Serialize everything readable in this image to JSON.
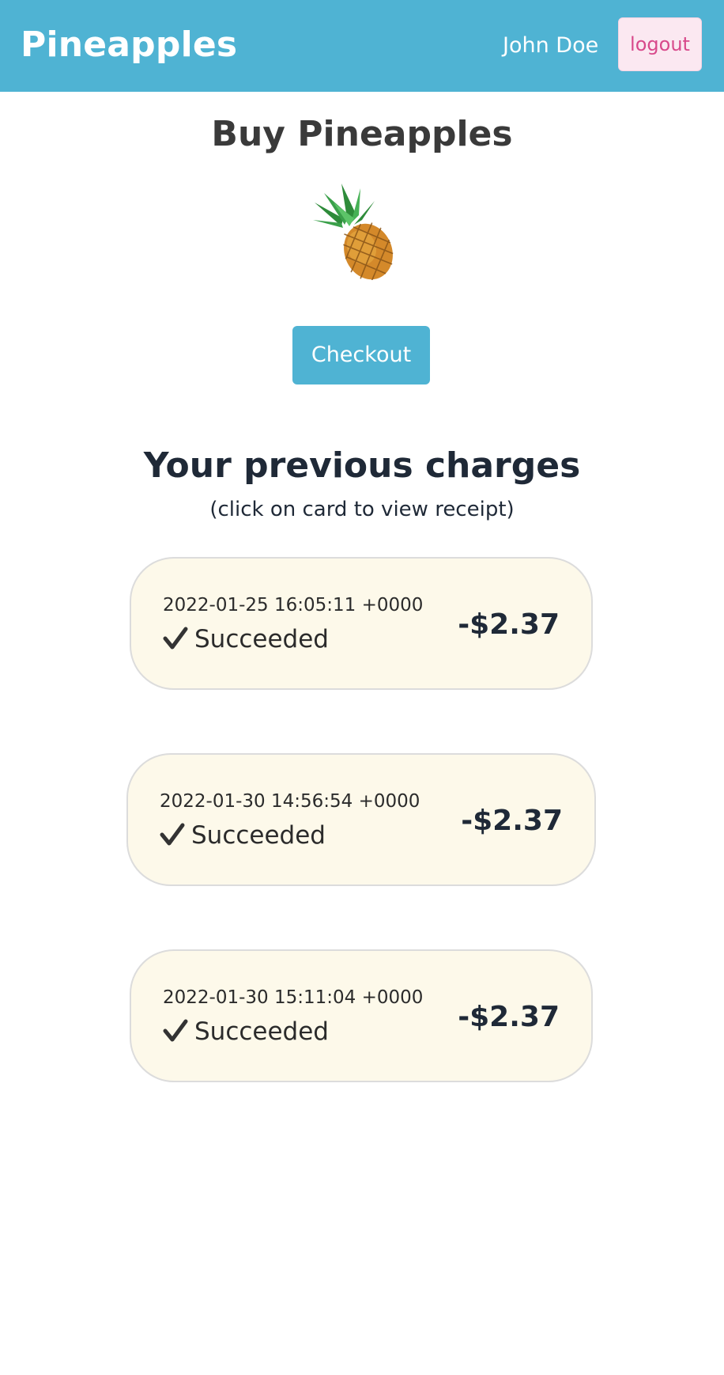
{
  "header": {
    "brand": "Pineapples",
    "user_name": "John Doe",
    "logout_label": "logout"
  },
  "main": {
    "title": "Buy Pineapples",
    "checkout_label": "Checkout",
    "previous_title": "Your previous charges",
    "previous_subtitle": "(click on card to view receipt)"
  },
  "charges": [
    {
      "date": "2022-01-25 16:05:11 +0000",
      "status": "Succeeded",
      "amount": "-$2.37"
    },
    {
      "date": "2022-01-30 14:56:54 +0000",
      "status": "Succeeded",
      "amount": "-$2.37"
    },
    {
      "date": "2022-01-30 15:11:04 +0000",
      "status": "Succeeded",
      "amount": "-$2.37"
    }
  ],
  "icons": {
    "product": "pineapple-icon",
    "status": "checkmark-icon"
  },
  "colors": {
    "header_bg": "#4fb3d3",
    "accent": "#4fb3d3",
    "logout_bg": "#fbe8f1",
    "logout_text": "#d8498b",
    "card_bg": "#fdf9ea"
  }
}
